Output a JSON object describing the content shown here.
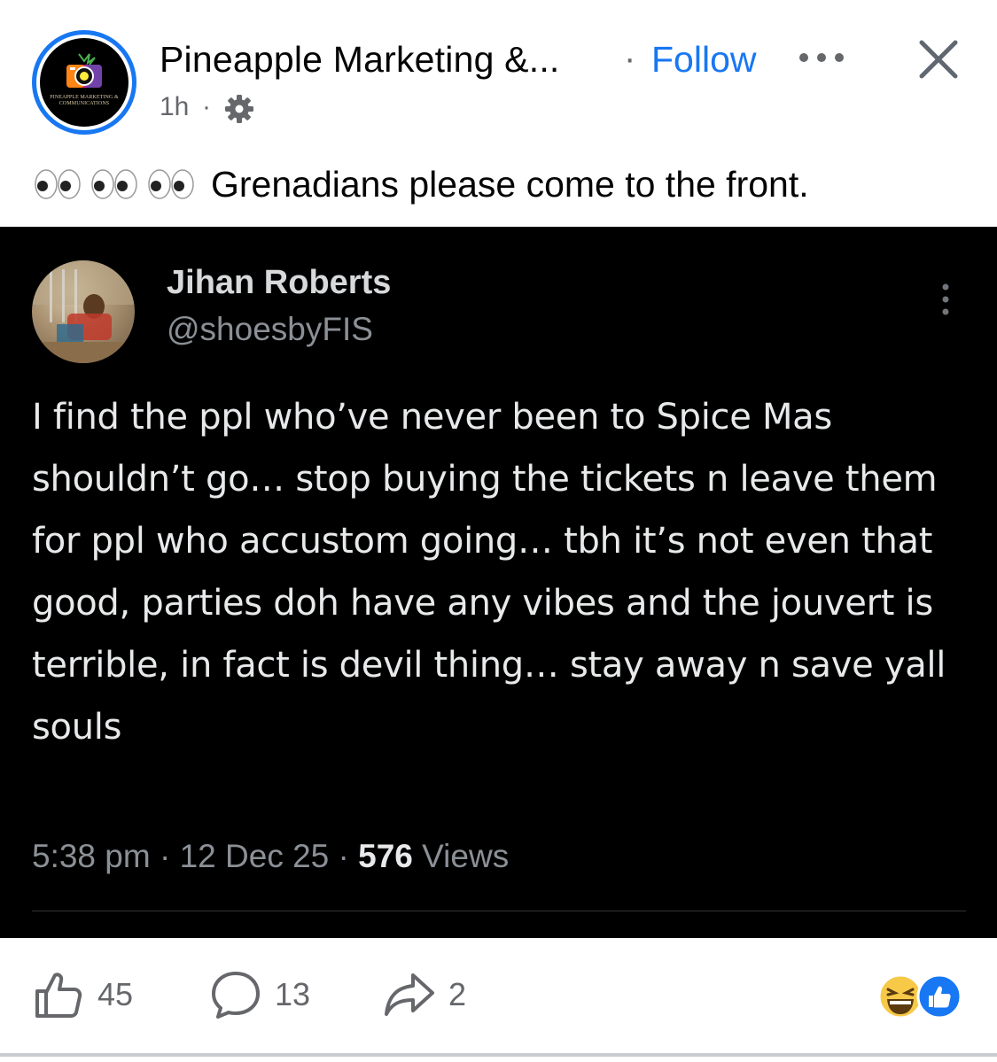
{
  "post": {
    "page_name": "Pineapple Marketing &...",
    "separator": "·",
    "follow_label": "Follow",
    "time": "1h",
    "time_separator": "·",
    "audience_icon": "gear-icon",
    "avatar_logo_text": "PINEAPPLE MARKETING & COMMUNICATIONS",
    "caption_emojis": [
      "eyes-emoji",
      "eyes-emoji",
      "eyes-emoji"
    ],
    "caption_text": "Grenadians please come to the front."
  },
  "tweet": {
    "display_name": "Jihan Roberts",
    "handle": "@shoesbyFIS",
    "body": "I find the ppl who’ve never been to Spice Mas shouldn’t go… stop buying the tickets n leave them for ppl who accustom going… tbh it’s not even that good, parties doh have any vibes and the jouvert is terrible, in fact is devil thing… stay away n save yall souls",
    "time": "5:38 pm",
    "date": "12 Dec 25",
    "views_count": "576",
    "views_label": "Views",
    "meta_separator": "·"
  },
  "actions": {
    "likes": "45",
    "comments": "13",
    "shares": "2",
    "reaction_icons": [
      "laughing-emoji",
      "like-reaction-icon"
    ]
  },
  "colors": {
    "accent": "#1877f2",
    "secondary_text": "#65676b",
    "tweet_background": "#000000",
    "tweet_text": "#e7e9ea"
  }
}
